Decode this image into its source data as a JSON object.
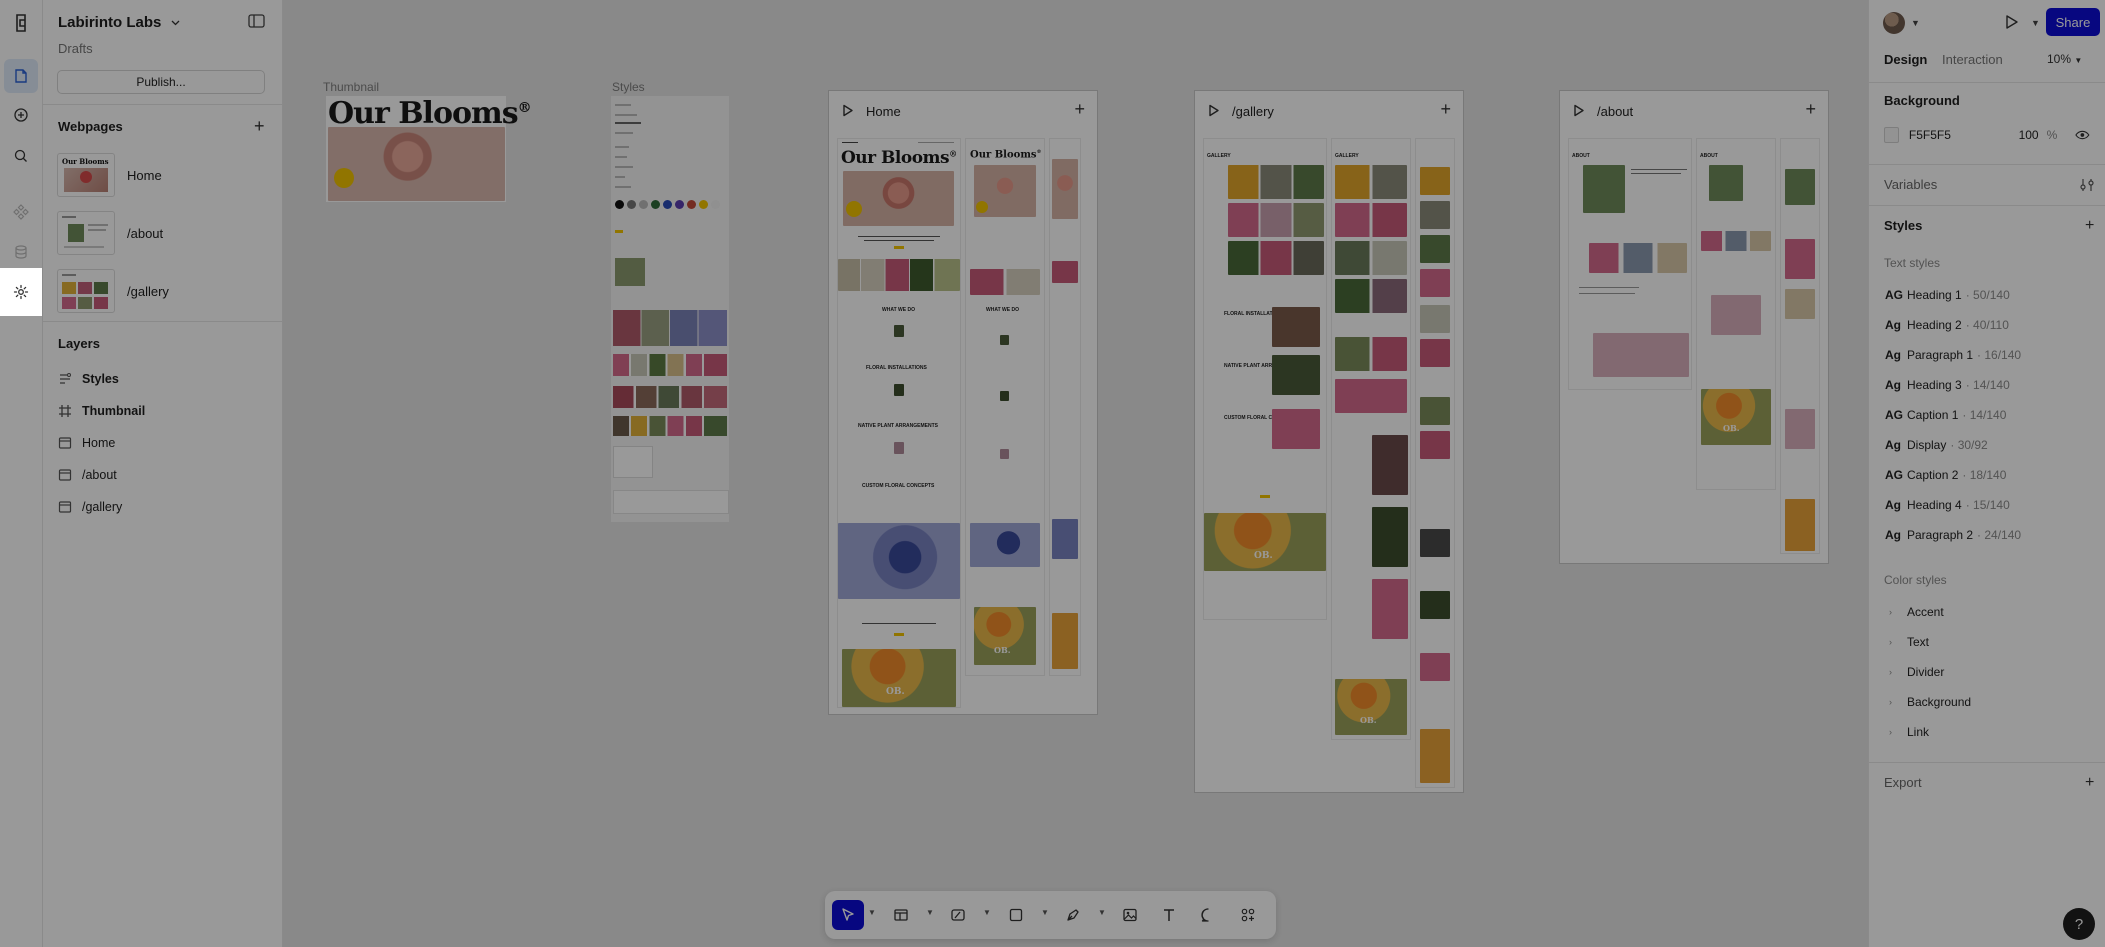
{
  "app": {
    "project_name": "Labirinto Labs",
    "project_location": "Drafts",
    "publish_label": "Publish..."
  },
  "webpages": {
    "title": "Webpages",
    "items": [
      {
        "name": "Home"
      },
      {
        "name": "/about"
      },
      {
        "name": "/gallery"
      }
    ]
  },
  "layers": {
    "title": "Layers",
    "items": [
      {
        "name": "Styles",
        "icon": "styles-icon"
      },
      {
        "name": "Thumbnail",
        "icon": "hash-frame-icon"
      },
      {
        "name": "Home",
        "icon": "page-frame-icon"
      },
      {
        "name": "/about",
        "icon": "page-frame-icon"
      },
      {
        "name": "/gallery",
        "icon": "page-frame-icon"
      }
    ]
  },
  "canvas": {
    "thumbnail_label": "Thumbnail",
    "styles_label": "Styles",
    "brand_heading": "Our Blooms",
    "brand_mark": "®",
    "logo_text": "OB.",
    "frames": [
      {
        "title": "Home"
      },
      {
        "title": "/gallery"
      },
      {
        "title": "/about"
      }
    ]
  },
  "right_panel": {
    "share_label": "Share",
    "tabs": [
      {
        "label": "Design"
      },
      {
        "label": "Interaction"
      }
    ],
    "zoom": "10%",
    "background": {
      "title": "Background",
      "hex": "F5F5F5",
      "opacity": "100",
      "opacity_unit": "%"
    },
    "variables_title": "Variables",
    "styles_title": "Styles",
    "text_styles_title": "Text styles",
    "text_styles": [
      {
        "name": "Heading 1",
        "meta": "· 50/140"
      },
      {
        "name": "Heading 2",
        "meta": "· 40/110"
      },
      {
        "name": "Paragraph 1",
        "meta": "· 16/140"
      },
      {
        "name": "Heading 3",
        "meta": "· 14/140"
      },
      {
        "name": "Caption 1",
        "meta": "· 14/140"
      },
      {
        "name": "Display",
        "meta": "· 30/92"
      },
      {
        "name": "Caption 2",
        "meta": "· 18/140"
      },
      {
        "name": "Heading 4",
        "meta": "· 15/140"
      },
      {
        "name": "Paragraph 2",
        "meta": "· 24/140"
      }
    ],
    "ag_glyph": "Ag",
    "ag_glyph_caps": "AG",
    "color_styles_title": "Color styles",
    "color_styles": [
      {
        "name": "Accent"
      },
      {
        "name": "Text"
      },
      {
        "name": "Divider"
      },
      {
        "name": "Background"
      },
      {
        "name": "Link"
      }
    ],
    "export_title": "Export"
  },
  "help_label": "?",
  "colors": {
    "accent": "#0d0dd6",
    "canvas": "#e5e5e5",
    "overlay": "rgba(0,0,0,0.40)",
    "highlight_yellow": "#f2c300"
  }
}
